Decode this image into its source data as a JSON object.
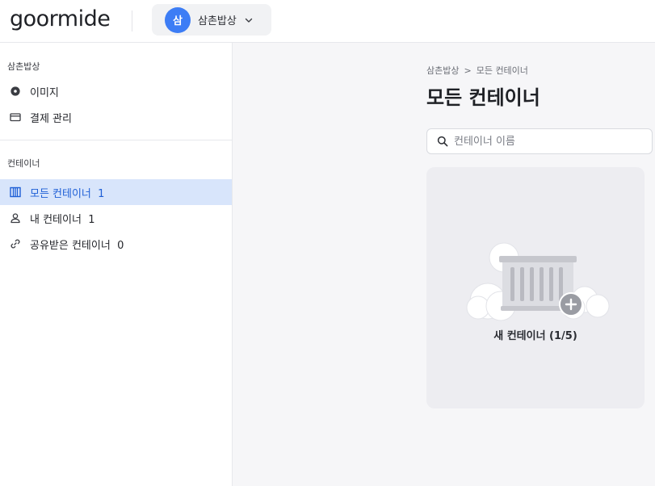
{
  "header": {
    "logo": "goormide",
    "workspace": {
      "avatar_letter": "삼",
      "name": "삼촌밥상",
      "accent": "#3d7df5"
    }
  },
  "sidebar": {
    "workspace_section_title": "삼촌밥상",
    "workspace_items": [
      {
        "label": "이미지",
        "icon": "disc-icon"
      },
      {
        "label": "결제 관리",
        "icon": "card-icon"
      }
    ],
    "container_section_title": "컨테이너",
    "container_items": [
      {
        "label": "모든 컨테이너",
        "count": "1",
        "icon": "container-icon",
        "active": true
      },
      {
        "label": "내 컨테이너",
        "count": "1",
        "icon": "user-icon",
        "active": false
      },
      {
        "label": "공유받은 컨테이너",
        "count": "0",
        "icon": "link-icon",
        "active": false
      }
    ]
  },
  "main": {
    "breadcrumb": [
      "삼촌밥상",
      "모든 컨테이너"
    ],
    "breadcrumb_separator": ">",
    "title": "모든 컨테이너",
    "search_placeholder": "컨테이너 이름",
    "new_container_label": "새 컨테이너 (1/5)"
  },
  "colors": {
    "active_bg": "#d8e5fb",
    "active_text": "#1e5fd6",
    "main_bg": "#f6f6f8"
  }
}
